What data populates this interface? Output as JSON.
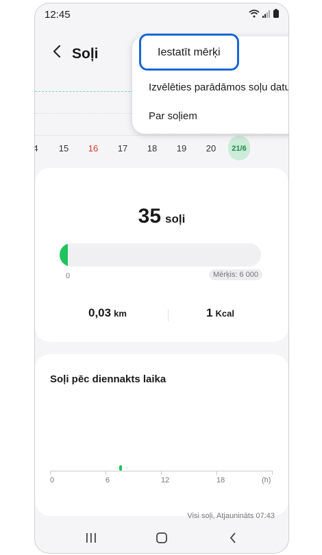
{
  "status": {
    "time": "12:45"
  },
  "appbar": {
    "title": "Soļi",
    "back_icon": "chevron-left-icon"
  },
  "week": {
    "days": [
      "4",
      "15",
      "16",
      "17",
      "18",
      "19",
      "20",
      "21/6"
    ],
    "red_day": "16",
    "selected_day": "21/6"
  },
  "summary": {
    "steps": "35",
    "steps_unit": "soļi",
    "progress_fraction": 0.006,
    "progress_min": "0",
    "goal_label": "Mērķis: 6 000",
    "distance_value": "0,03",
    "distance_unit": "km",
    "calories_value": "1",
    "calories_unit": "Kcal"
  },
  "hourly": {
    "title": "Soļi pēc diennakts laika",
    "x_ticks": [
      "0",
      "6",
      "12",
      "18",
      "(h)"
    ],
    "chart_data": {
      "type": "bar",
      "x": [
        7.5
      ],
      "values": [
        1
      ],
      "xlim": [
        0,
        24
      ],
      "xlabel": "(h)"
    }
  },
  "footer": {
    "updated": "Visi soļi, Atjaunināts 07:43"
  },
  "menu": {
    "items": [
      "Iestatīt mērķi",
      "Izvēlēties parādāmos soļu datus",
      "Par soļiem"
    ]
  },
  "colors": {
    "accent_green": "#20c35e",
    "highlight_blue": "#1765d8",
    "red_day": "#d23b2e"
  }
}
